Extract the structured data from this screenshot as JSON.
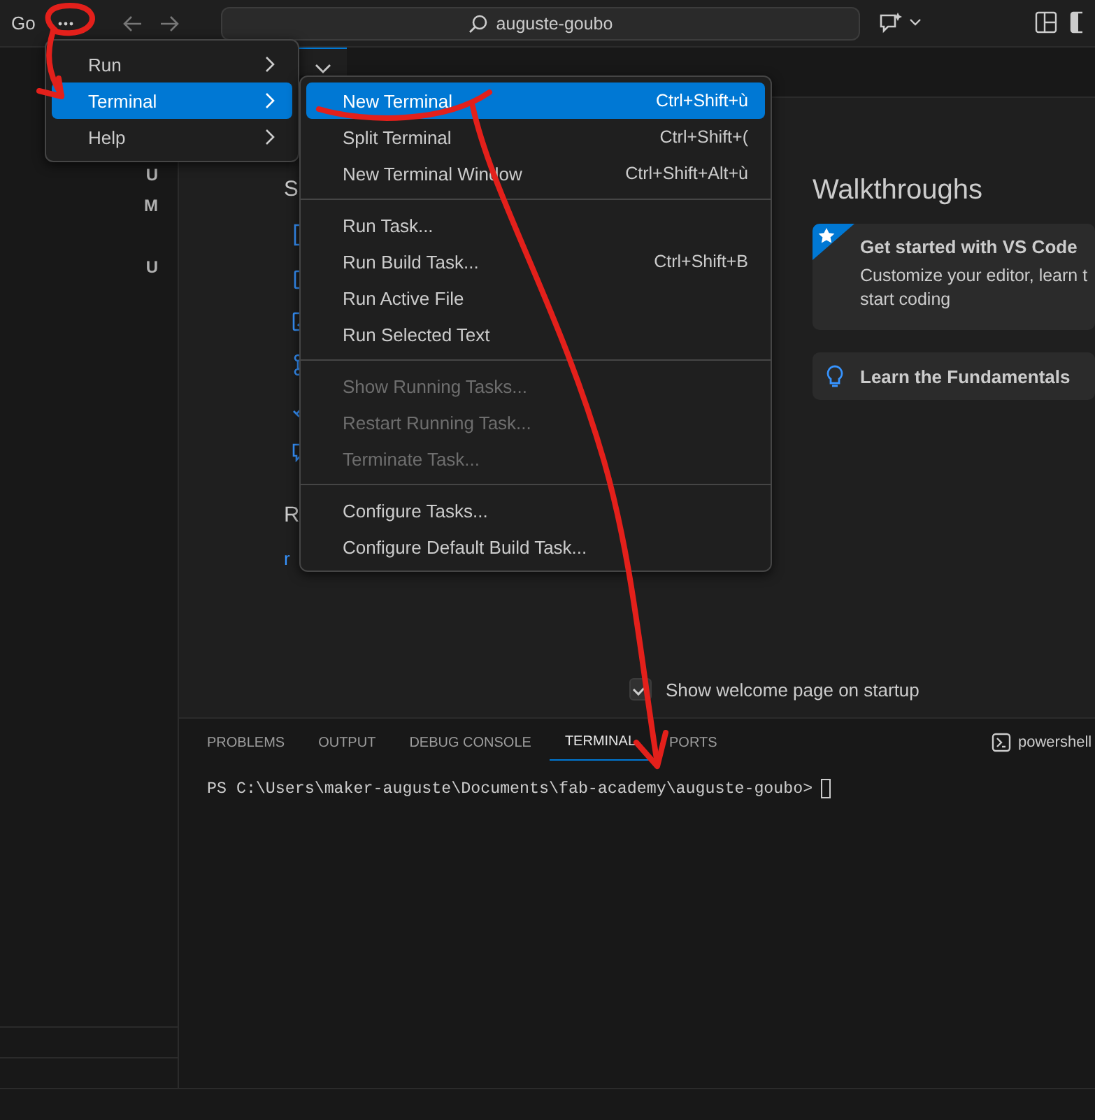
{
  "title_bar": {
    "menu_label": "Go",
    "search": "auguste-goubo"
  },
  "sidebar": {
    "rows": [
      {
        "badge": "U"
      },
      {
        "badge": "M"
      },
      {},
      {
        "badge": "U"
      }
    ]
  },
  "menu": {
    "items": [
      {
        "label": "Run",
        "selected": false
      },
      {
        "label": "Terminal",
        "selected": true
      },
      {
        "label": "Help",
        "selected": false
      }
    ]
  },
  "submenu": {
    "groups": [
      [
        {
          "label": "New Terminal",
          "shortcut": "Ctrl+Shift+ù",
          "disabled": false,
          "selected": true
        },
        {
          "label": "Split Terminal",
          "shortcut": "Ctrl+Shift+(",
          "disabled": false,
          "selected": false
        },
        {
          "label": "New Terminal Window",
          "shortcut": "Ctrl+Shift+Alt+ù",
          "disabled": false,
          "selected": false
        }
      ],
      [
        {
          "label": "Run Task...",
          "disabled": false,
          "selected": false
        },
        {
          "label": "Run Build Task...",
          "shortcut": "Ctrl+Shift+B",
          "disabled": false,
          "selected": false
        },
        {
          "label": "Run Active File",
          "disabled": false,
          "selected": false
        },
        {
          "label": "Run Selected Text",
          "disabled": false,
          "selected": false
        }
      ],
      [
        {
          "label": "Show Running Tasks...",
          "disabled": true,
          "selected": false
        },
        {
          "label": "Restart Running Task...",
          "disabled": true,
          "selected": false
        },
        {
          "label": "Terminate Task...",
          "disabled": true,
          "selected": false
        }
      ],
      [
        {
          "label": "Configure Tasks...",
          "disabled": false,
          "selected": false
        },
        {
          "label": "Configure Default Build Task...",
          "disabled": false,
          "selected": false
        }
      ]
    ]
  },
  "welcome": {
    "start_heading": "S",
    "recent_heading": "R",
    "recent_link": "r",
    "walkthroughs_title": "Walkthroughs",
    "walkthroughs": [
      {
        "kind": "featured",
        "title": "Get started with VS Code",
        "description_lines": [
          "Customize your editor, learn t",
          "start coding"
        ]
      },
      {
        "kind": "plain",
        "title": "Learn the Fundamentals"
      }
    ],
    "show_on_startup": {
      "label": "Show welcome page on startup",
      "checked": true
    }
  },
  "panel": {
    "tabs": [
      {
        "label": "PROBLEMS",
        "selected": false
      },
      {
        "label": "OUTPUT",
        "selected": false
      },
      {
        "label": "DEBUG CONSOLE",
        "selected": false
      },
      {
        "label": "TERMINAL",
        "selected": true
      },
      {
        "label": "PORTS",
        "selected": false
      }
    ],
    "shell": "powershell",
    "terminal_line": "PS C:\\Users\\maker-auguste\\Documents\\fab-academy\\auguste-goubo>"
  }
}
